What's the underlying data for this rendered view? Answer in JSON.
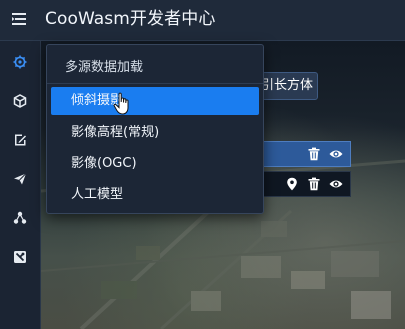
{
  "header": {
    "title": "CooWasm开发者中心",
    "menu_icon": "hamburger-menu-icon"
  },
  "sidebar": {
    "items": [
      {
        "icon": "gear-icon",
        "active": true
      },
      {
        "icon": "cube-icon",
        "active": false
      },
      {
        "icon": "edit-note-icon",
        "active": false
      },
      {
        "icon": "paper-plane-icon",
        "active": false
      },
      {
        "icon": "molecule-icon",
        "active": false
      },
      {
        "icon": "tools-icon",
        "active": false
      }
    ]
  },
  "layer_panel": {
    "cuboid_button_label": "引长方体",
    "rows": [
      {
        "selected": true,
        "icons": [
          "trash-icon",
          "eye-icon"
        ]
      },
      {
        "selected": false,
        "icons": [
          "location-pin-icon",
          "trash-icon",
          "eye-icon"
        ]
      }
    ]
  },
  "dropdown": {
    "title": "多源数据加载",
    "items": [
      {
        "label": "倾斜摄影",
        "active": true
      },
      {
        "label": "影像高程(常规)",
        "active": false
      },
      {
        "label": "影像(OGC)",
        "active": false
      },
      {
        "label": "人工模型",
        "active": false
      }
    ]
  },
  "colors": {
    "accent": "#1a7df0",
    "header_bg": "#1f2a3a",
    "sidebar_active": "#3b8ff5",
    "sidebar_icon": "#e6ebf1"
  }
}
